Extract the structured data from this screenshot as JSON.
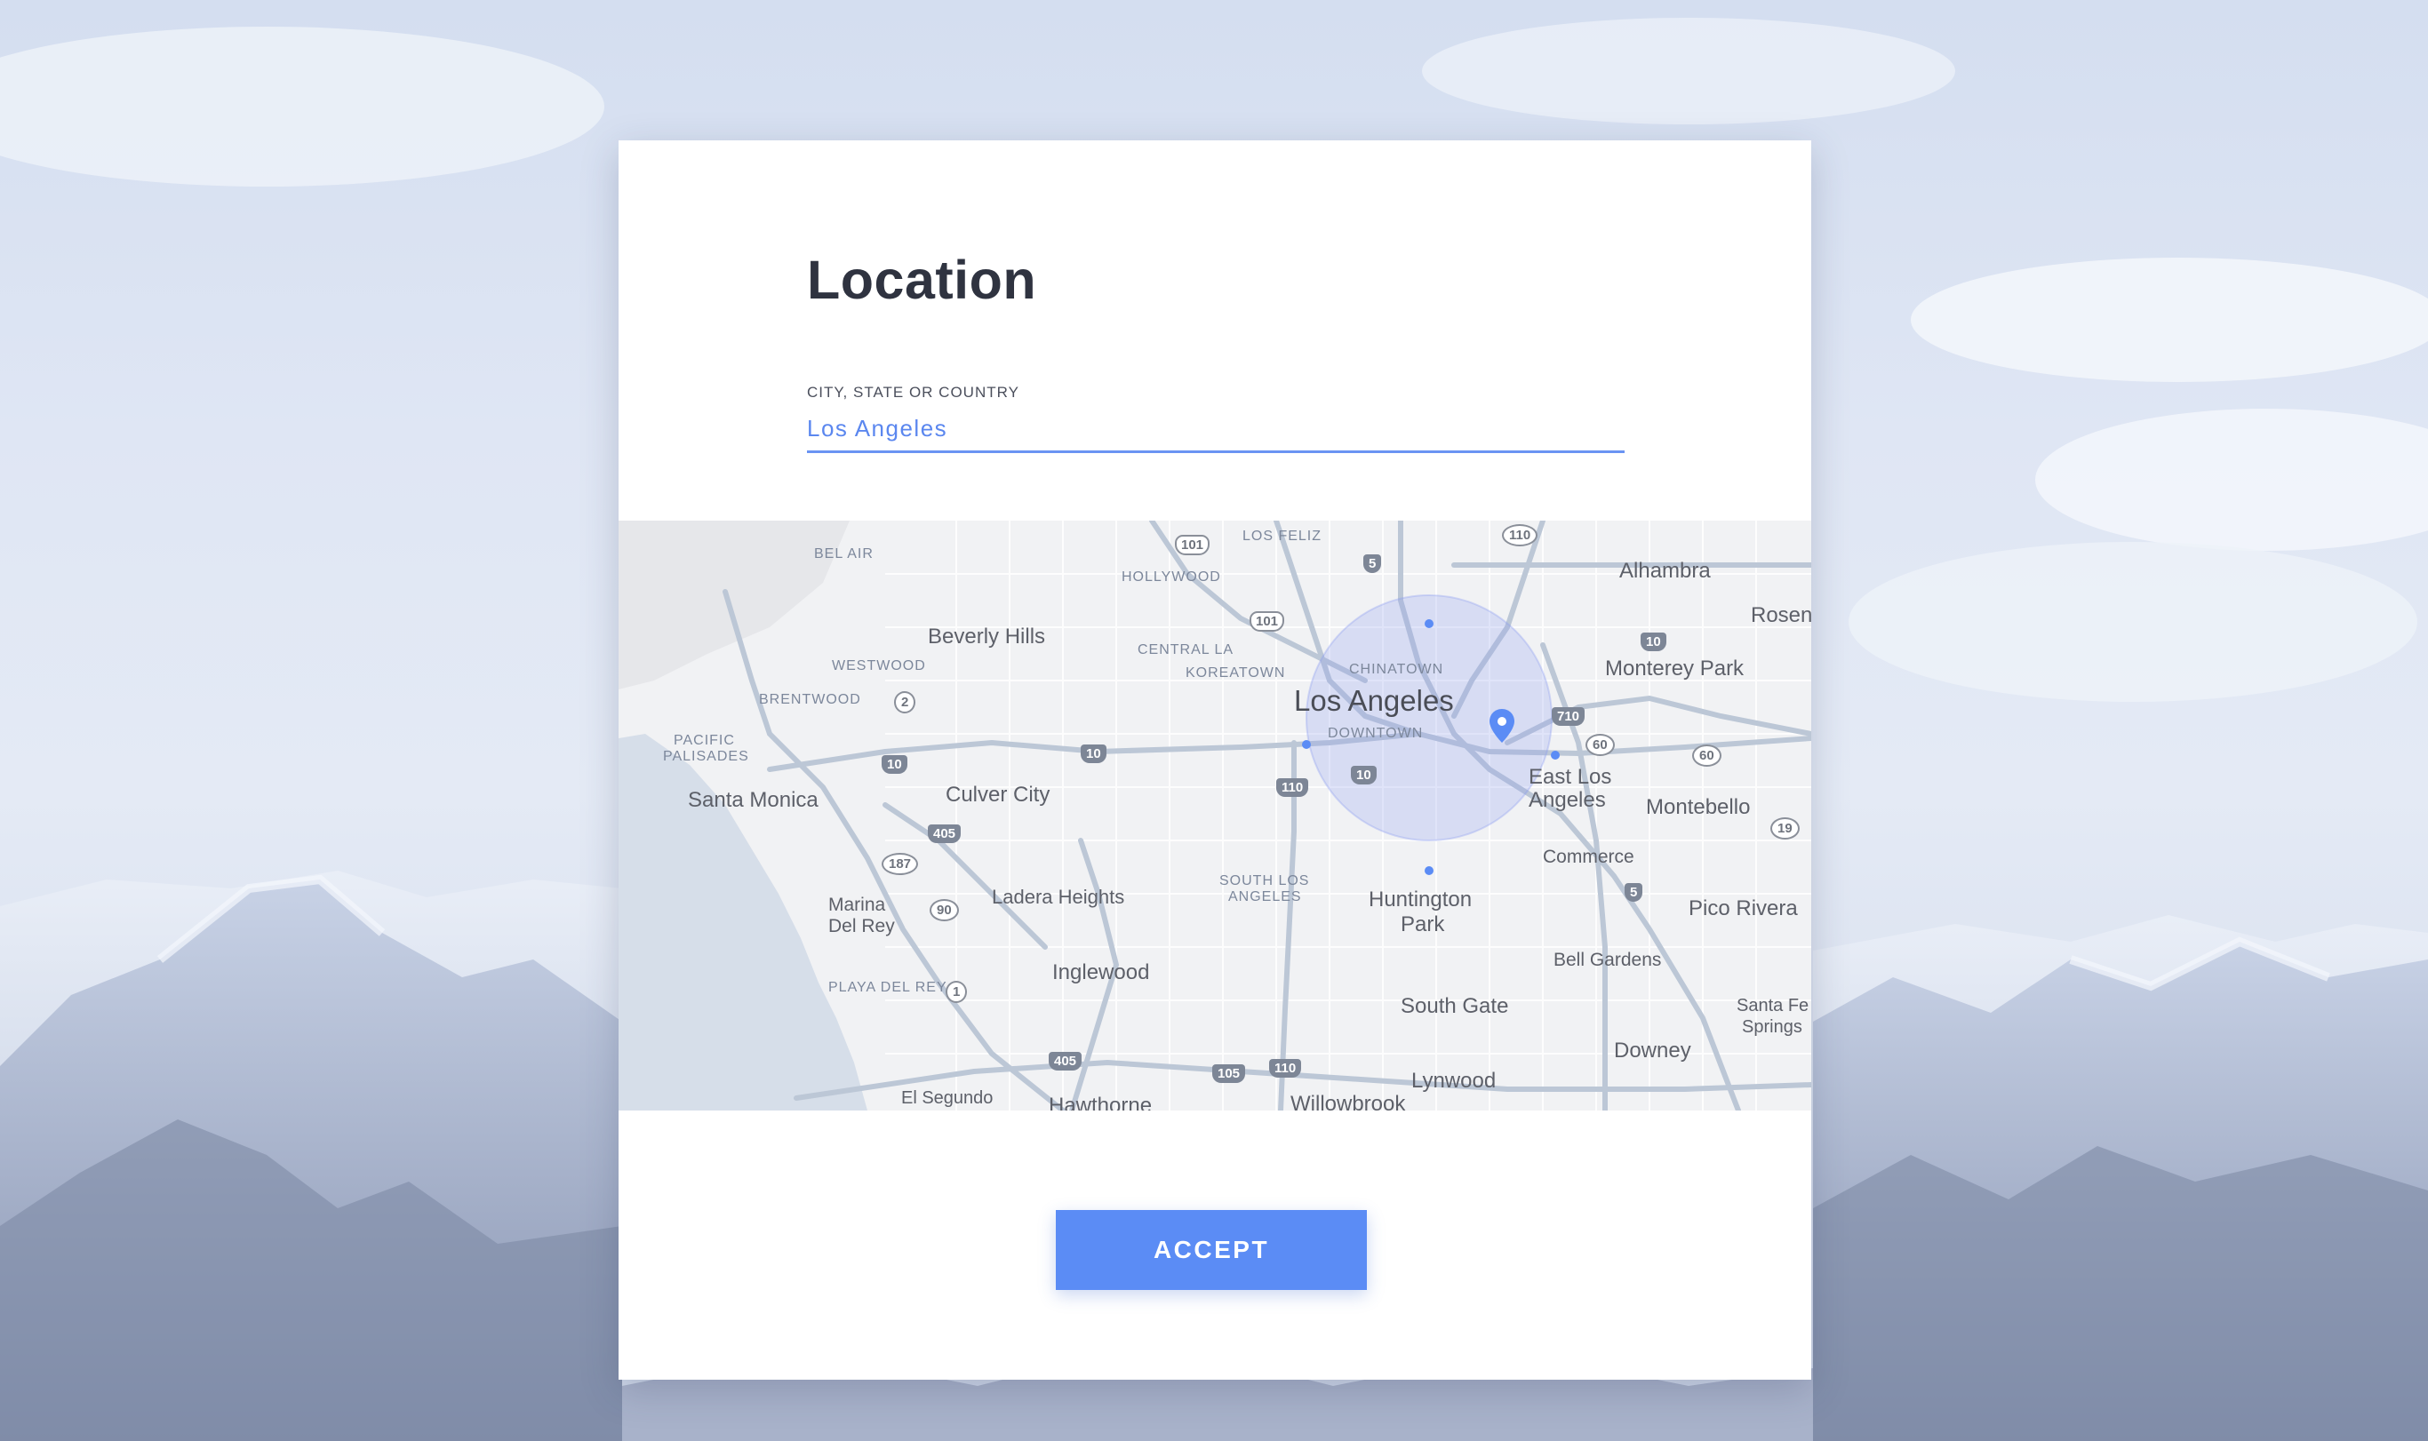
{
  "background": {
    "image_name": "snowy-mountain-landscape"
  },
  "form": {
    "title": "Location",
    "field_label": "CITY, STATE OR COUNTRY",
    "field_value": "Los Angeles"
  },
  "map": {
    "cities": {
      "los_angeles": "Los Angeles",
      "beverly_hills": "Beverly Hills",
      "santa_monica": "Santa Monica",
      "culver_city": "Culver City",
      "alhambra": "Alhambra",
      "rosemead": "Rosen",
      "monterey_park": "Monterey Park",
      "east_la_1": "East Los",
      "east_la_2": "Angeles",
      "montebello": "Montebello",
      "commerce": "Commerce",
      "huntington_1": "Huntington",
      "huntington_2": "Park",
      "pico_rivera": "Pico Rivera",
      "marina_1": "Marina",
      "marina_2": "Del Rey",
      "ladera": "Ladera Heights",
      "inglewood": "Inglewood",
      "south_gate": "South Gate",
      "bell_gardens": "Bell Gardens",
      "santa_fe_1": "Santa Fe",
      "santa_fe_2": "Springs",
      "downey": "Downey",
      "lynwood": "Lynwood",
      "el_segundo": "El Segundo",
      "hawthorne": "Hawthorne",
      "willowbrook": "Willowbrook"
    },
    "neighborhoods": {
      "bel_air": "BEL AIR",
      "los_feliz": "LOS FELIZ",
      "hollywood": "HOLLYWOOD",
      "central_la": "CENTRAL LA",
      "koreatown": "KOREATOWN",
      "chinatown": "CHINATOWN",
      "downtown": "DOWNTOWN",
      "westwood": "WESTWOOD",
      "brentwood": "BRENTWOOD",
      "pacific_1": "PACIFIC",
      "pacific_2": "PALISADES",
      "south_la_1": "SOUTH LOS",
      "south_la_2": "ANGELES",
      "playa": "PLAYA DEL REY"
    },
    "shields": {
      "s101a": "101",
      "s101b": "101",
      "s110a": "110",
      "s5a": "5",
      "s10a": "10",
      "s710": "710",
      "s60a": "60",
      "s60b": "60",
      "s2": "2",
      "s10b": "10",
      "s10c": "10",
      "s110b": "110",
      "s10d": "10",
      "s405a": "405",
      "s187": "187",
      "s19": "19",
      "s5b": "5",
      "s90": "90",
      "s1": "1",
      "s405b": "405",
      "s105": "105",
      "s110c": "110"
    }
  },
  "actions": {
    "accept_label": "ACCEPT"
  },
  "colors": {
    "accent": "#5b8cf5",
    "title": "#2f3340",
    "input_text": "#5b87ef"
  }
}
